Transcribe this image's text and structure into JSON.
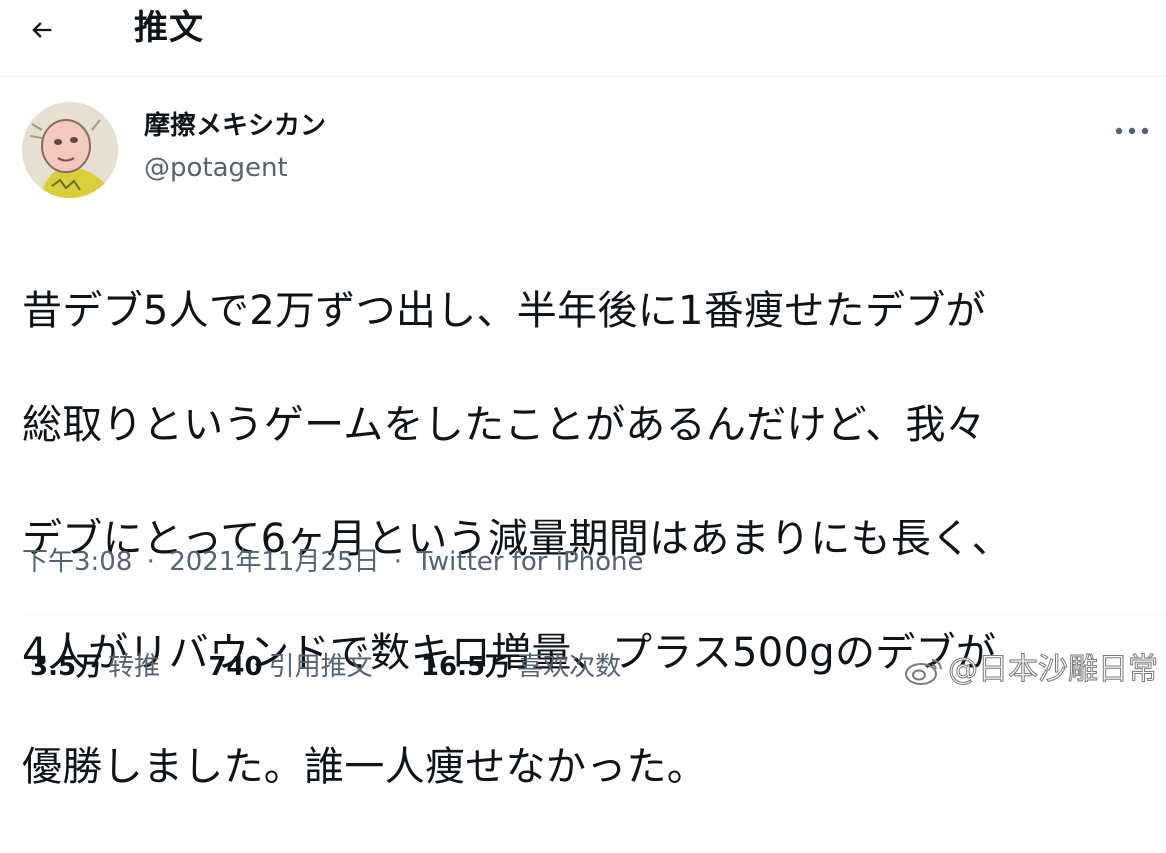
{
  "header": {
    "title": "推文"
  },
  "author": {
    "display_name": "摩擦メキシカン",
    "handle": "@potagent"
  },
  "tweet": {
    "lines": [
      "昔デブ5人で2万ずつ出し、半年後に1番痩せたデブが",
      "総取りというゲームをしたことがあるんだけど、我々",
      "デブにとって6ヶ月という減量期間はあまりにも長く、",
      "4人がリバウンドで数キロ増量、プラス500gのデブが",
      "優勝しました。誰一人痩せなかった。"
    ]
  },
  "meta": {
    "time": "下午3:08",
    "date": "2021年11月25日",
    "separator": "·",
    "source": "Twitter for iPhone"
  },
  "stats": [
    {
      "value": "3.5万",
      "label": "转推"
    },
    {
      "value": "740",
      "label": "引用推文"
    },
    {
      "value": "16.5万",
      "label": "喜欢次数"
    }
  ],
  "watermark": {
    "text": "@日本沙雕日常"
  },
  "icons": {
    "back": "arrow-left-icon",
    "more": "more-horizontal-icon",
    "watermark": "weibo-icon"
  },
  "colors": {
    "text_primary": "#0f1419",
    "text_secondary": "#536471",
    "divider": "#eff3f4"
  }
}
